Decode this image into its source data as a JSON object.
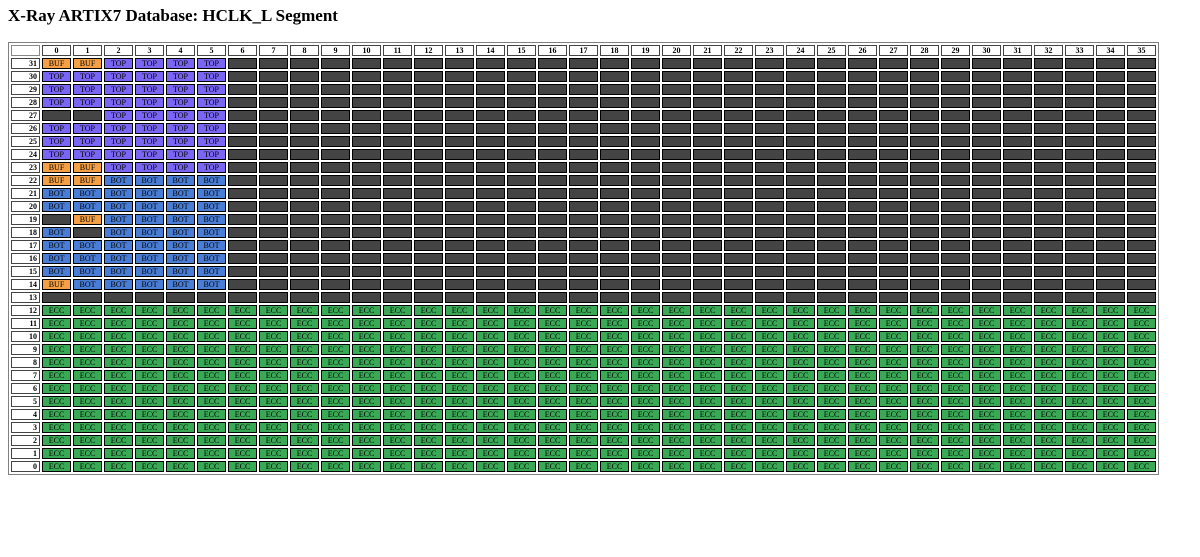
{
  "title": "X-Ray ARTIX7 Database: HCLK_L Segment",
  "columns": [
    "0",
    "1",
    "2",
    "3",
    "4",
    "5",
    "6",
    "7",
    "8",
    "9",
    "10",
    "11",
    "12",
    "13",
    "14",
    "15",
    "16",
    "17",
    "18",
    "19",
    "20",
    "21",
    "22",
    "23",
    "24",
    "25",
    "26",
    "27",
    "28",
    "29",
    "30",
    "31",
    "32",
    "33",
    "34",
    "35"
  ],
  "row_labels": [
    "31",
    "30",
    "29",
    "28",
    "27",
    "26",
    "25",
    "24",
    "23",
    "22",
    "21",
    "20",
    "19",
    "18",
    "17",
    "16",
    "15",
    "14",
    "13",
    "12",
    "11",
    "10",
    "9",
    "8",
    "7",
    "6",
    "5",
    "4",
    "3",
    "2",
    "1",
    "0"
  ],
  "row_cells": [
    [
      "BUF",
      "BUF",
      "TOP",
      "TOP",
      "TOP",
      "TOP"
    ],
    [
      "TOP",
      "TOP",
      "TOP",
      "TOP",
      "TOP",
      "TOP"
    ],
    [
      "TOP",
      "TOP",
      "TOP",
      "TOP",
      "TOP",
      "TOP"
    ],
    [
      "TOP",
      "TOP",
      "TOP",
      "TOP",
      "TOP",
      "TOP"
    ],
    [
      "",
      "",
      "TOP",
      "TOP",
      "TOP",
      "TOP"
    ],
    [
      "TOP",
      "TOP",
      "TOP",
      "TOP",
      "TOP",
      "TOP"
    ],
    [
      "TOP",
      "TOP",
      "TOP",
      "TOP",
      "TOP",
      "TOP"
    ],
    [
      "TOP",
      "TOP",
      "TOP",
      "TOP",
      "TOP",
      "TOP"
    ],
    [
      "BUF",
      "BUF",
      "TOP",
      "TOP",
      "TOP",
      "TOP"
    ],
    [
      "BUF",
      "BUF",
      "BOT",
      "BOT",
      "BOT",
      "BOT"
    ],
    [
      "BOT",
      "BOT",
      "BOT",
      "BOT",
      "BOT",
      "BOT"
    ],
    [
      "BOT",
      "BOT",
      "BOT",
      "BOT",
      "BOT",
      "BOT"
    ],
    [
      "",
      "BUF",
      "BOT",
      "BOT",
      "BOT",
      "BOT"
    ],
    [
      "BOT",
      "",
      "BOT",
      "BOT",
      "BOT",
      "BOT"
    ],
    [
      "BOT",
      "BOT",
      "BOT",
      "BOT",
      "BOT",
      "BOT"
    ],
    [
      "BOT",
      "BOT",
      "BOT",
      "BOT",
      "BOT",
      "BOT"
    ],
    [
      "BOT",
      "BOT",
      "BOT",
      "BOT",
      "BOT",
      "BOT"
    ],
    [
      "BUF",
      "BOT",
      "BOT",
      "BOT",
      "BOT",
      "BOT"
    ],
    [],
    [
      "ECC"
    ],
    [
      "ECC"
    ],
    [
      "ECC"
    ],
    [
      "ECC"
    ],
    [
      "ECC"
    ],
    [
      "ECC"
    ],
    [
      "ECC"
    ],
    [
      "ECC"
    ],
    [
      "ECC"
    ],
    [
      "ECC"
    ],
    [
      "ECC"
    ],
    [
      "ECC"
    ],
    [
      "ECC"
    ]
  ],
  "colors": {
    "BUF": "#f5a046",
    "TOP": "#7a66f4",
    "BOT": "#4a7ed6",
    "ECC": "#3aa956",
    "empty": "#444444"
  }
}
